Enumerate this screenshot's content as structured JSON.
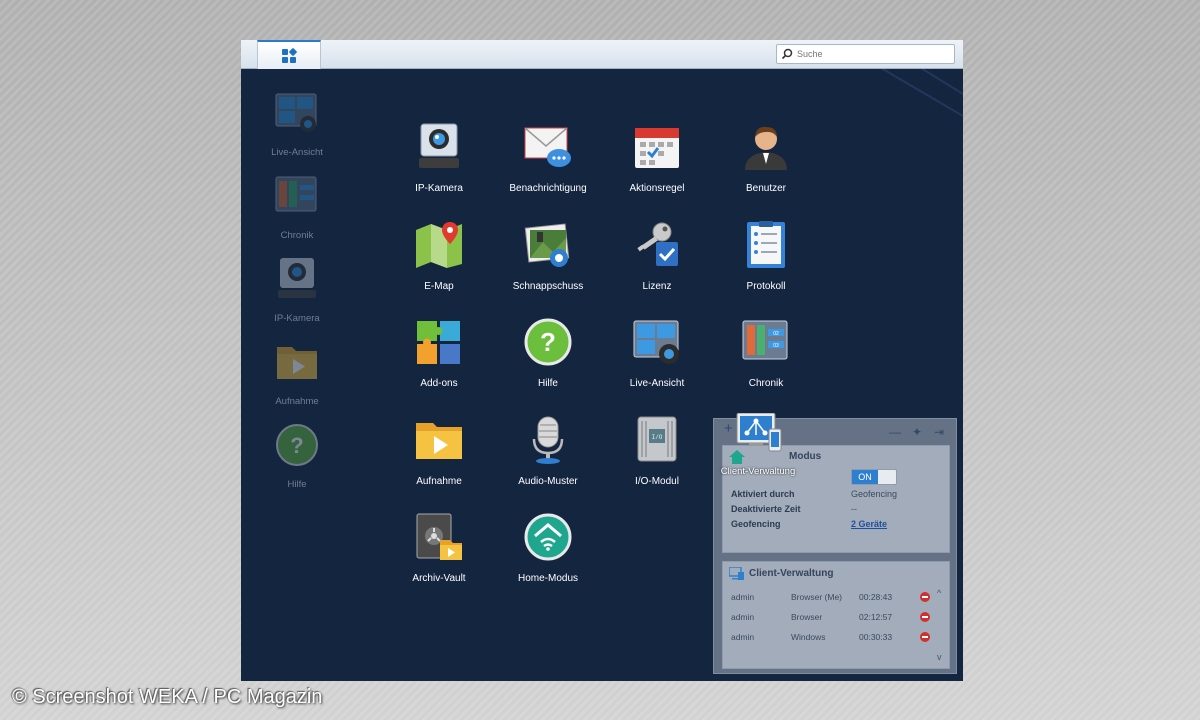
{
  "header": {
    "search_placeholder": "Suche"
  },
  "desktop_shortcuts": [
    {
      "label": "Live-Ansicht",
      "icon": "live-view-icon"
    },
    {
      "label": "Chronik",
      "icon": "timeline-icon"
    },
    {
      "label": "IP-Kamera",
      "icon": "ip-camera-icon"
    },
    {
      "label": "Aufnahme",
      "icon": "recording-folder-icon"
    },
    {
      "label": "Hilfe",
      "icon": "help-icon"
    }
  ],
  "apps": [
    {
      "label": "IP-Kamera",
      "icon": "ip-camera-icon"
    },
    {
      "label": "Benachrichtigung",
      "icon": "notification-icon"
    },
    {
      "label": "Aktionsregel",
      "icon": "calendar-icon"
    },
    {
      "label": "Benutzer",
      "icon": "user-icon"
    },
    {
      "label": "E-Map",
      "icon": "map-icon"
    },
    {
      "label": "Schnappschuss",
      "icon": "snapshot-icon"
    },
    {
      "label": "Lizenz",
      "icon": "license-key-icon"
    },
    {
      "label": "Protokoll",
      "icon": "log-clipboard-icon"
    },
    {
      "label": "Add-ons",
      "icon": "puzzle-icon"
    },
    {
      "label": "Hilfe",
      "icon": "help-icon"
    },
    {
      "label": "Live-Ansicht",
      "icon": "live-view-icon"
    },
    {
      "label": "Chronik",
      "icon": "timeline-icon"
    },
    {
      "label": "Aufnahme",
      "icon": "recording-folder-icon"
    },
    {
      "label": "Audio-Muster",
      "icon": "microphone-icon"
    },
    {
      "label": "I/O-Modul",
      "icon": "io-module-icon"
    },
    {
      "label": "Archiv-Vault",
      "icon": "archive-vault-icon"
    },
    {
      "label": "Home-Modus",
      "icon": "home-mode-icon"
    }
  ],
  "dragging": {
    "label": "Client-Verwaltung",
    "icon": "client-management-icon"
  },
  "widget": {
    "home_mode": {
      "title": "Modus",
      "toggle": "ON",
      "rows": [
        {
          "key": "Aktiviert durch",
          "value": "Geofencing"
        },
        {
          "key": "Deaktivierte Zeit",
          "value": "--"
        },
        {
          "key": "Geofencing",
          "value": "2 Geräte"
        }
      ]
    },
    "client_mgmt": {
      "title": "Client-Verwaltung",
      "rows": [
        {
          "user": "admin",
          "client": "Browser (Me)",
          "time": "00:28:43"
        },
        {
          "user": "admin",
          "client": "Browser",
          "time": "02:12:57"
        },
        {
          "user": "admin",
          "client": "Windows",
          "time": "00:30:33"
        }
      ]
    }
  },
  "copyright": "© Screenshot WEKA / PC Magazin",
  "colors": {
    "desktop_bg": "#142540",
    "accent": "#2a7ad0",
    "stop_red": "#d2302c"
  }
}
